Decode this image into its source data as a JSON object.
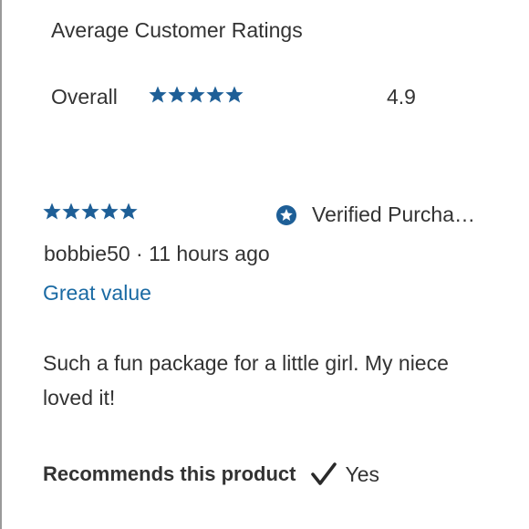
{
  "average": {
    "title": "Average Customer Ratings",
    "overall_label": "Overall",
    "overall_stars": 5,
    "overall_score": "4.9"
  },
  "review": {
    "stars": 5,
    "verified_text": "Verified Purcha…",
    "reviewer": "bobbie50",
    "separator": "·",
    "time_ago": "11 hours ago",
    "title": "Great value",
    "body": "Such a fun package for a little girl. My niece loved it!",
    "recommends_label": "Recommends this product",
    "recommends_value": "Yes"
  },
  "colors": {
    "star": "#1e5f97",
    "link": "#1a6aa3",
    "text": "#333333",
    "verified_icon": "#1e5f97"
  },
  "icons": {
    "star": "star-icon",
    "verified": "verified-badge-icon",
    "check": "checkmark-icon"
  }
}
